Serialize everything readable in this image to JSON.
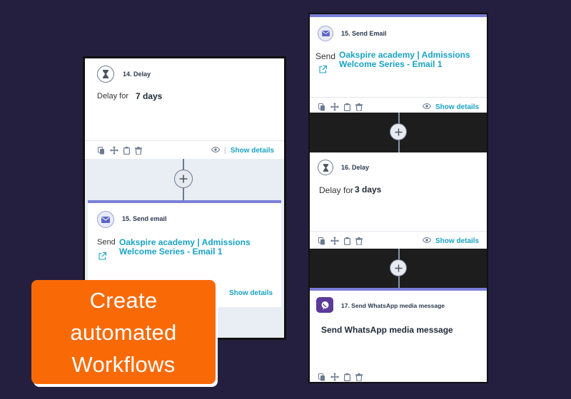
{
  "left_panel": {
    "delay_card": {
      "title": "14. Delay",
      "label": "Delay for",
      "value": "7 days",
      "show_details": "Show details"
    },
    "email_card": {
      "title": "15. Send email",
      "label": "Send",
      "link": "Oakspire academy | Admissions Welcome Series - Email 1",
      "show_details": "Show details"
    }
  },
  "right_panel": {
    "email_card": {
      "title": "15. Send Email",
      "label": "Send",
      "link": "Oakspire academy | Admissions Welcome Series - Email 1",
      "show_details": "Show details"
    },
    "delay_card": {
      "title": "16. Delay",
      "label": "Delay for",
      "value": "3 days",
      "show_details": "Show details"
    },
    "whatsapp_card": {
      "title": "17. Send WhatsApp media message",
      "body": "Send WhatsApp media message"
    }
  },
  "cta": {
    "line1": "Create",
    "line2": "automated",
    "line3": "Workflows"
  },
  "colors": {
    "background": "#251f3f",
    "accent_link": "#19a3c4",
    "cta_orange": "#f96a07",
    "card_top_bar": "#7b7fd8"
  }
}
